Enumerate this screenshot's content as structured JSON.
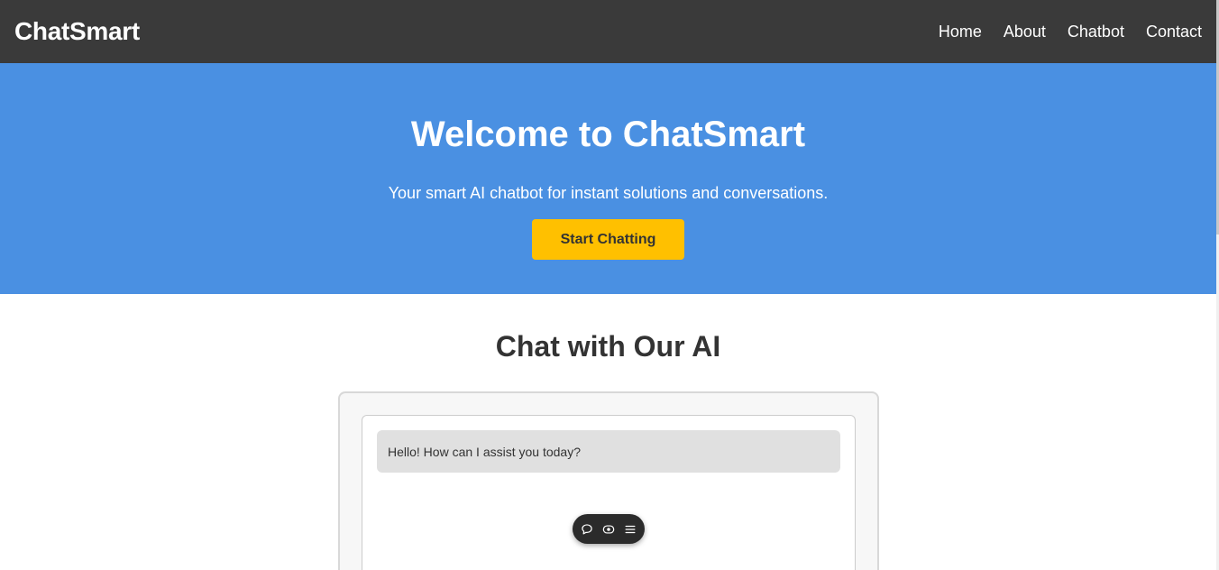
{
  "navbar": {
    "brand": "ChatSmart",
    "links": [
      "Home",
      "About",
      "Chatbot",
      "Contact"
    ]
  },
  "hero": {
    "title": "Welcome to ChatSmart",
    "subtitle": "Your smart AI chatbot for instant solutions and conversations.",
    "button_label": "Start Chatting"
  },
  "chat_section": {
    "title": "Chat with Our AI",
    "messages": [
      {
        "sender": "bot",
        "text": "Hello! How can I assist you today?"
      }
    ]
  },
  "toolbar": {
    "icons": [
      "chat-bubble-icon",
      "eye-icon",
      "menu-icon"
    ]
  },
  "colors": {
    "navbar_bg": "#3a3a3a",
    "hero_bg": "#4a90e2",
    "cta_button": "#ffc000",
    "bot_message_bg": "#e0e0e0"
  }
}
